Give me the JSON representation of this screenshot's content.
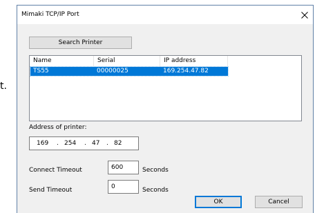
{
  "background": {
    "fragment_text": "t."
  },
  "dialog": {
    "title": "Mimaki TCP/IP Port",
    "close_icon": "close-icon",
    "search_button_label": "Search Printer",
    "printer_list": {
      "columns": [
        "Name",
        "Serial",
        "IP address"
      ],
      "rows": [
        {
          "name": "TS55",
          "serial": "00000025",
          "ip": "169.254.47.82",
          "selected": true
        }
      ]
    },
    "address_label": "Address of printer:",
    "ip_address": {
      "octet1": "169",
      "octet2": "254",
      "octet3": "47",
      "octet4": "82",
      "separator": "."
    },
    "connect_timeout": {
      "label": "Connect Timeout",
      "value": "600",
      "unit": "Seconds"
    },
    "send_timeout": {
      "label": "Send Timeout",
      "value": "0",
      "unit": "Seconds"
    },
    "ok_label": "OK",
    "cancel_label": "Cancel"
  },
  "colors": {
    "selection": "#0078d7",
    "dialog_border": "#5f7fa6",
    "client_area": "#f0f0f0"
  }
}
